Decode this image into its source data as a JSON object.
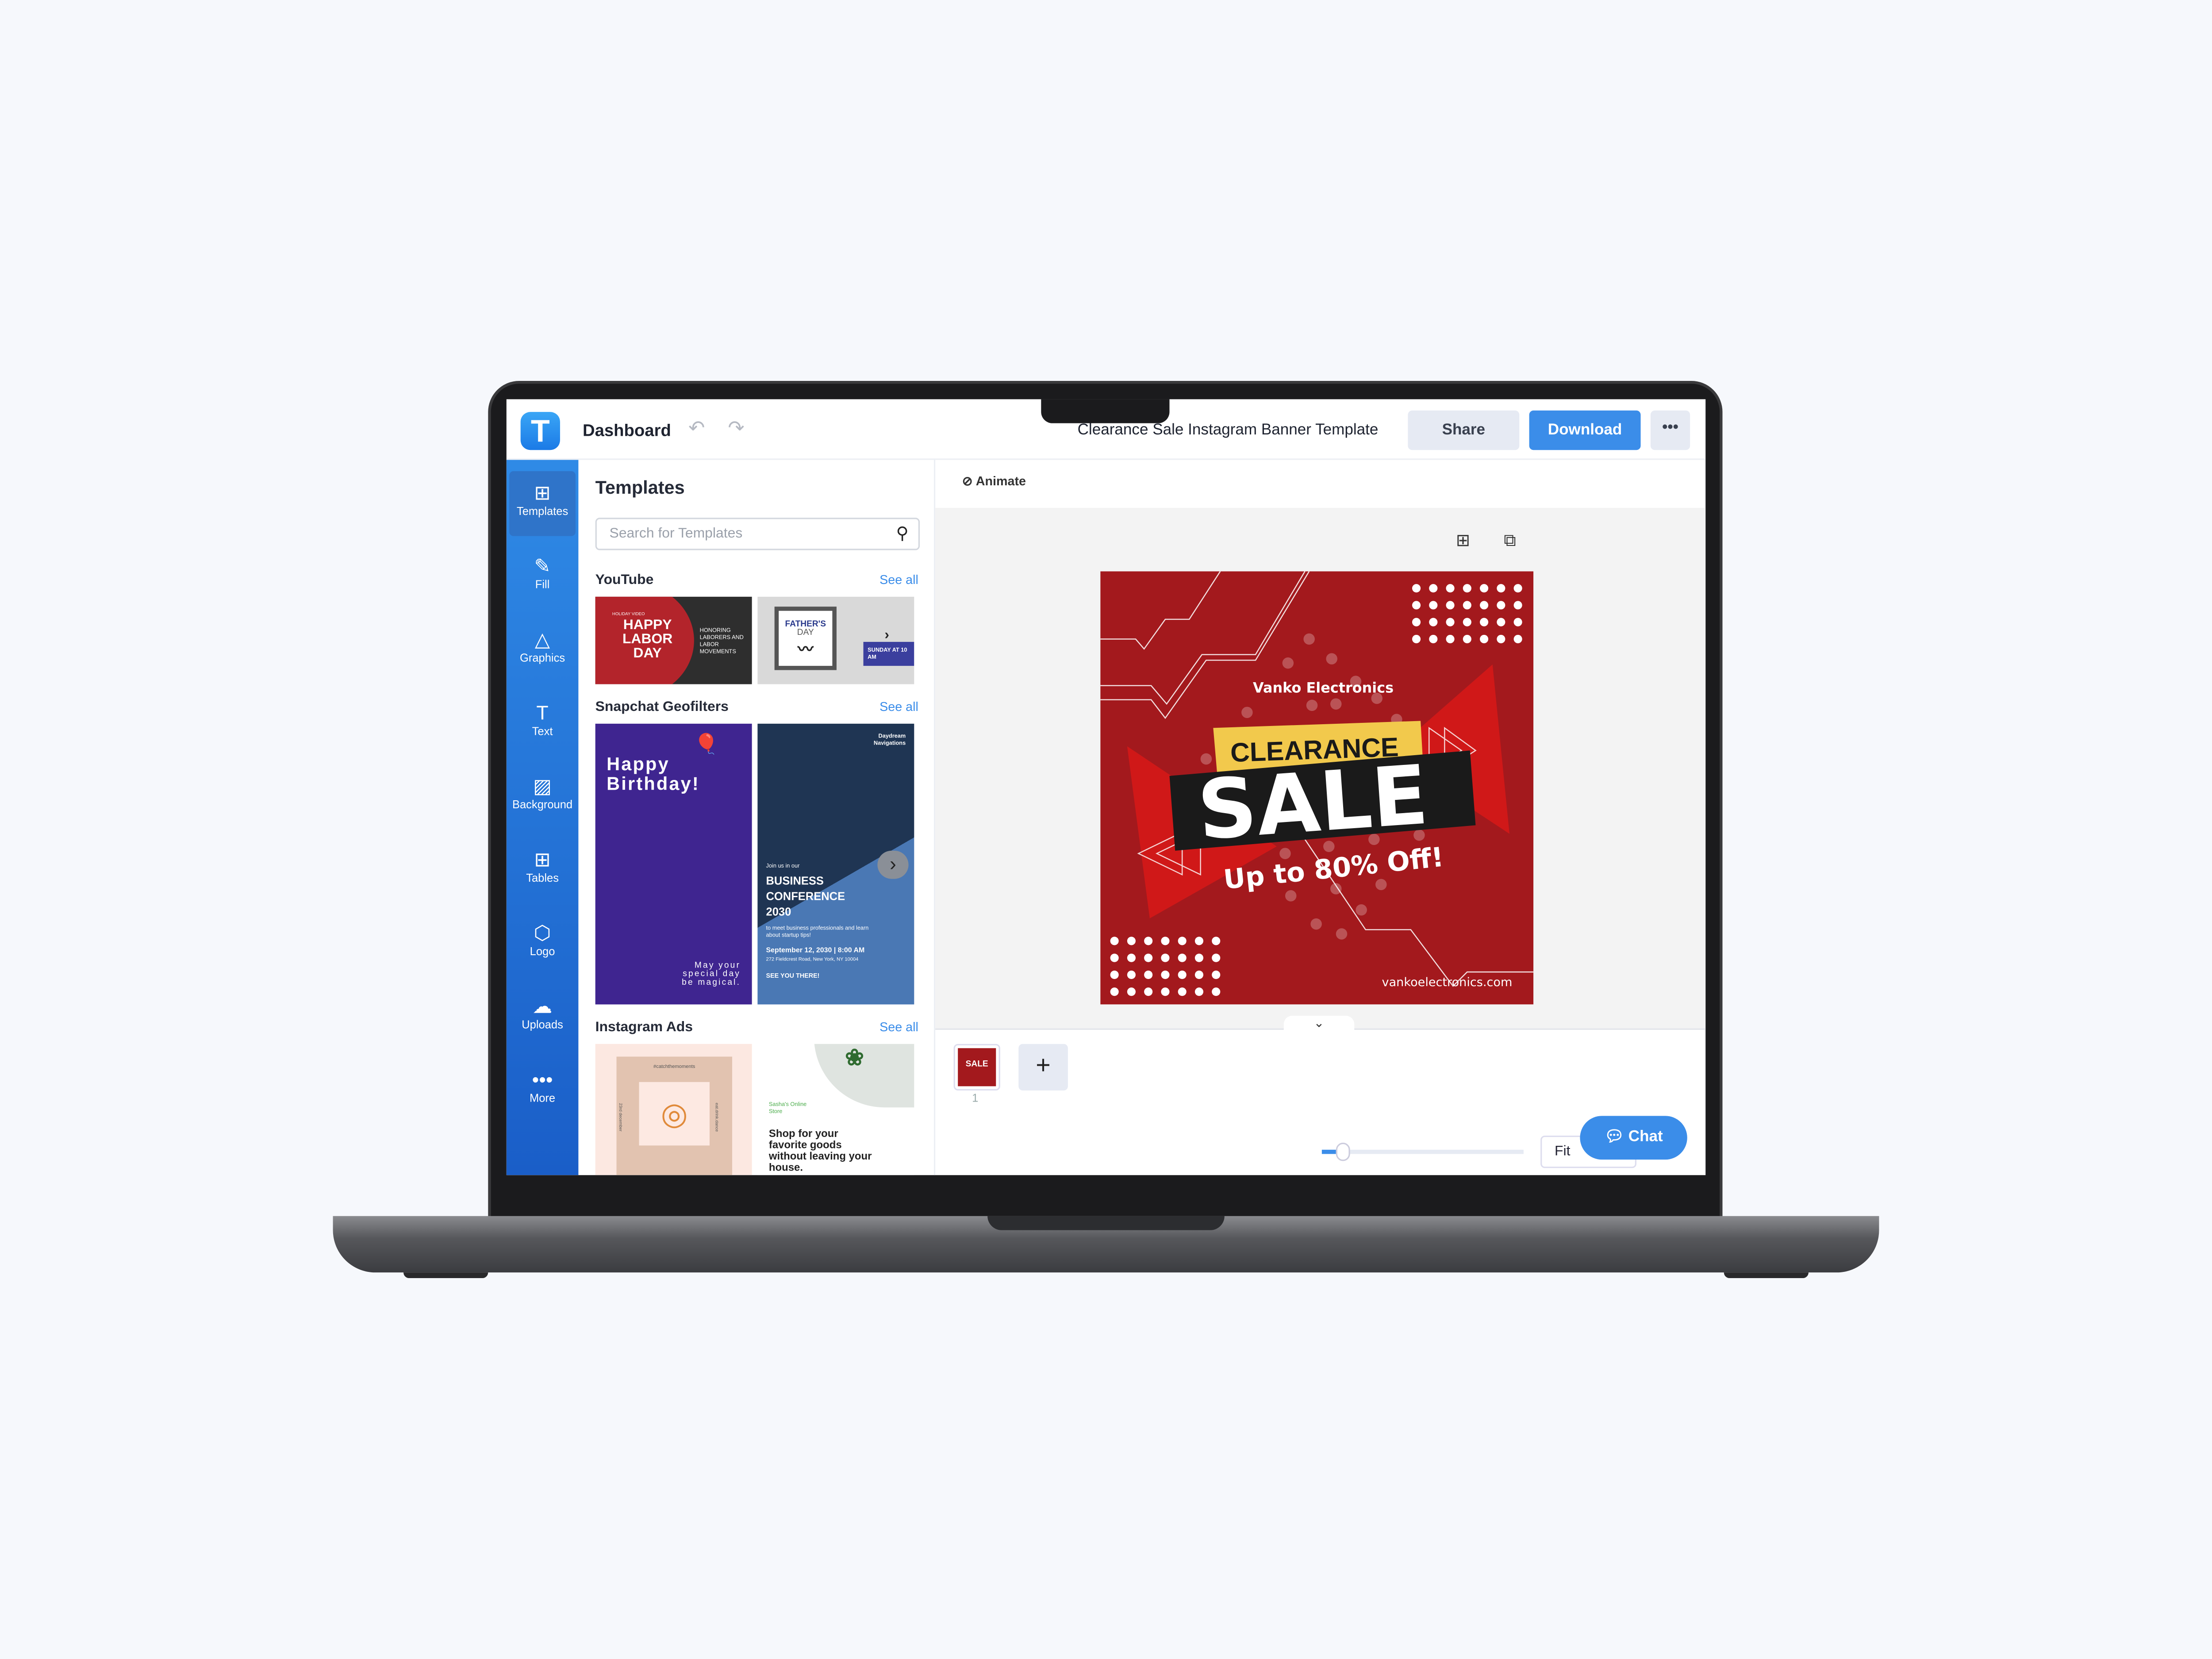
{
  "app": {
    "logo_letter": "T",
    "dashboard_label": "Dashboard",
    "document_title": "Clearance Sale Instagram Banner Template",
    "share_label": "Share",
    "download_label": "Download",
    "more_label": "•••",
    "brand_color": "#3b8de9"
  },
  "sidebar": {
    "items": [
      {
        "label": "Templates",
        "icon": "templates-icon",
        "glyph": "⊞",
        "active": true
      },
      {
        "label": "Fill",
        "icon": "pencil-icon",
        "glyph": "✎"
      },
      {
        "label": "Graphics",
        "icon": "shapes-icon",
        "glyph": "△"
      },
      {
        "label": "Text",
        "icon": "text-icon",
        "glyph": "T"
      },
      {
        "label": "Background",
        "icon": "background-icon",
        "glyph": "▨"
      },
      {
        "label": "Tables",
        "icon": "table-icon",
        "glyph": "⊞"
      },
      {
        "label": "Logo",
        "icon": "logo-icon",
        "glyph": "⬡"
      },
      {
        "label": "Uploads",
        "icon": "cloud-upload-icon",
        "glyph": "☁"
      },
      {
        "label": "More",
        "icon": "more-icon",
        "glyph": "•••"
      }
    ]
  },
  "panel": {
    "title": "Templates",
    "search_placeholder": "Search for Templates",
    "sections": [
      {
        "title": "YouTube",
        "see_all": "See all",
        "templates": [
          {
            "kicker": "HOLIDAY VIDEO",
            "title": "HAPPY LABOR DAY",
            "subtitle": "HONORING LABORERS AND LABOR MOVEMENTS"
          },
          {
            "title": "FATHER'S",
            "subtitle": "DAY",
            "badge": "SUNDAY AT 10 AM"
          }
        ]
      },
      {
        "title": "Snapchat Geofilters",
        "see_all": "See all",
        "templates": [
          {
            "title": "Happy Birthday!",
            "subtitle": "May your special day be magical."
          },
          {
            "brand": "Daydream Navigations",
            "kicker": "Join us in our",
            "title": "BUSINESS CONFERENCE 2030",
            "subtitle": "to meet business professionals and learn about startup tips!",
            "date": "September 12, 2030 | 8:00 AM",
            "address": "272 Fieldcrest Road, New York, NY 10004",
            "cta": "SEE YOU THERE!"
          }
        ]
      },
      {
        "title": "Instagram Ads",
        "see_all": "See all",
        "templates": [
          {
            "hashtag": "#catchthemoments",
            "left": "23rd december",
            "right": "eat.drink.dance"
          },
          {
            "brand": "Sasha's Online Store",
            "title": "Shop for your favorite goods without leaving your house."
          }
        ]
      }
    ]
  },
  "editor": {
    "animate_label": "Animate",
    "design": {
      "brand": "Vanko Electronics",
      "headline_top": "CLEARANCE",
      "headline": "SALE",
      "offer": "Up to 80% Off!",
      "website": "vankoelectronics.com",
      "colors": {
        "background": "#a3191d",
        "accent": "#f2c94c",
        "band": "#1a1a1a",
        "triangle": "#d01818"
      }
    },
    "pages": [
      {
        "number": "1"
      }
    ],
    "add_page_label": "+",
    "zoom_fit_label": "Fit",
    "zoom_level_fraction": 0.07,
    "chat_label": "Chat"
  }
}
